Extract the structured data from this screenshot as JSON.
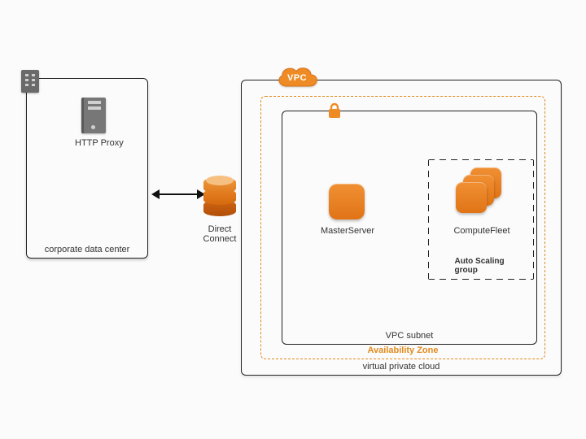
{
  "corp": {
    "label": "corporate data center",
    "proxy_label": "HTTP Proxy"
  },
  "connect": {
    "label": "Direct Connect"
  },
  "vpc": {
    "badge": "VPC",
    "label": "virtual private cloud",
    "az_label": "Availability Zone",
    "subnet_label": "VPC subnet"
  },
  "nodes": {
    "master": "MasterServer",
    "fleet": "ComputeFleet",
    "asg": "Auto Scaling group"
  },
  "colors": {
    "orange": "#e07a1e",
    "az_orange": "#e08a1c"
  }
}
